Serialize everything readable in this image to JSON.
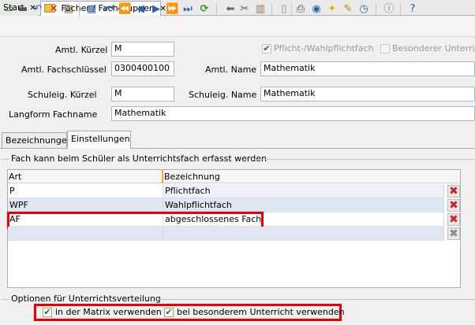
{
  "tabs": [
    {
      "label": "Start",
      "close": "✕"
    },
    {
      "label": "Fächer / Fachgruppen",
      "close": "✕"
    }
  ],
  "toolbar": {
    "icons": [
      "new-icon",
      "save-icon",
      "undo-icon",
      "delete-icon",
      "edit-icon",
      "copy-icon",
      "first-icon",
      "prev-page-icon",
      "prev-icon",
      "next-icon",
      "next-page-icon",
      "last-icon",
      "refresh-icon",
      "back-icon",
      "cut-icon",
      "paste-icon",
      "print-icon",
      "view-icon",
      "bulb-icon",
      "wand-icon",
      "clock-icon",
      "info-icon",
      "help-icon"
    ]
  },
  "form": {
    "amtl_kuerzel_label": "Amtl. Kürzel",
    "amtl_kuerzel_value": "M",
    "pflicht_label": "Pflicht-/Wahlpflichtfach",
    "besonderer_label": "Besonderer Unterricht",
    "amtl_schluessel_label": "Amtl. Fachschlüssel",
    "amtl_schluessel_value": "0300400100",
    "amtl_name_label": "Amtl. Name",
    "amtl_name_value": "Mathematik",
    "schuleig_kuerzel_label": "Schuleig. Kürzel",
    "schuleig_kuerzel_value": "M",
    "schuleig_name_label": "Schuleig. Name",
    "schuleig_name_value": "Mathematik",
    "langform_label": "Langform Fachname",
    "langform_value": "Mathematik"
  },
  "subtabs": {
    "bezeichnungen": "Bezeichnungen",
    "einstellungen": "Einstellungen"
  },
  "grid": {
    "group_title": "Fach kann beim Schüler als Unterrichtsfach erfasst werden",
    "col_art": "Art",
    "col_bezeichnung": "Bezeichnung",
    "rows": [
      {
        "art": "P",
        "bezeichnung": "Pflichtfach"
      },
      {
        "art": "WPF",
        "bezeichnung": "Wahlpflichtfach"
      },
      {
        "art": "AF",
        "bezeichnung": "abgeschlossenes Fach"
      }
    ],
    "delete_glyph": "✖"
  },
  "options": {
    "group_title": "Optionen für Unterrichtsverteilung",
    "matrix_label": "in der Matrix verwenden",
    "besonderem_label": "bei besonderem Unterricht verwenden",
    "check_glyph": "✔"
  },
  "colors": {
    "highlight": "#ee0000",
    "row_alt": "#dde6f2",
    "delete_red": "#d62020"
  }
}
